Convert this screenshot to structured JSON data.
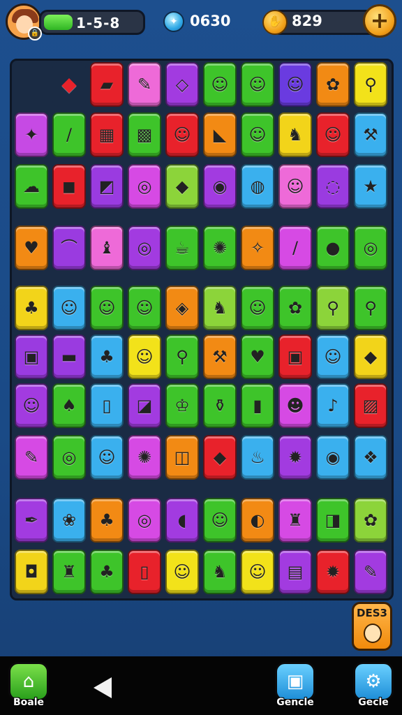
{
  "hud": {
    "level_text": "1-5-8",
    "level_progress": 0.3,
    "lock_glyph": "🔒",
    "gem_count": "0630",
    "gem_glyph": "✦",
    "coin_count": "829",
    "coin_glyph": "✋",
    "plus_label": "+"
  },
  "board": {
    "rows": [
      [
        "",
        "◆",
        "▰",
        "✎",
        "◇",
        "☺",
        "☺",
        "☺",
        "✿",
        "⚲"
      ],
      [
        "✦",
        "/",
        "▦",
        "▩",
        "☺",
        "◣",
        "☺",
        "♞",
        "☺",
        "⚒"
      ],
      [
        "☁",
        "◼",
        "◩",
        "◎",
        "◆",
        "◉",
        "◍",
        "☺",
        "◌",
        "★"
      ],
      [
        "♥",
        "⌒",
        "♝",
        "◎",
        "☕",
        "✺",
        "✧",
        "/",
        "●",
        "◎"
      ],
      [
        "♣",
        "☺",
        "☺",
        "☺",
        "◈",
        "♞",
        "☺",
        "✿",
        "⚲",
        "⚲"
      ],
      [
        "▣",
        "▬",
        "♣",
        "☺",
        "⚲",
        "⚒",
        "♥",
        "▣",
        "☺",
        "◆"
      ],
      [
        "☺",
        "♠",
        "▯",
        "◪",
        "♔",
        "⚱",
        "▮",
        "☻",
        "♪",
        "▨"
      ],
      [
        "✎",
        "◎",
        "☺",
        "✺",
        "◫",
        "◆",
        "♨",
        "✹",
        "◉",
        "❖"
      ],
      [
        "✒",
        "❀",
        "♣",
        "◎",
        "◖",
        "☺",
        "◐",
        "♜",
        "◨",
        "✿"
      ],
      [
        "◘",
        "♜",
        "♣",
        "▯",
        "☺",
        "♞",
        "☺",
        "▤",
        "✹",
        "✎"
      ]
    ],
    "colors": [
      [
        "#1a2b44",
        "#1a2b44",
        "#e8222b",
        "#ee6ad8",
        "#a23be0",
        "#3ec42a",
        "#3ec42a",
        "#6a3be0",
        "#f28a14",
        "#f2e21a"
      ],
      [
        "#c64ae4",
        "#3ec42a",
        "#e8222b",
        "#3ec42a",
        "#e8222b",
        "#f28a14",
        "#3ec42a",
        "#f2d41a",
        "#e8222b",
        "#3ab0ee"
      ],
      [
        "#3ec42a",
        "#e8222b",
        "#9a3be0",
        "#d64ae4",
        "#8cd43a",
        "#a23be0",
        "#3ab0ee",
        "#ee6ad8",
        "#9a3be0",
        "#3ab0ee"
      ],
      [
        "#f28a14",
        "#9a3be0",
        "#ee6ad8",
        "#a23be0",
        "#3ec42a",
        "#3ec42a",
        "#f28a14",
        "#d64ae4",
        "#3ec42a",
        "#3ec42a"
      ],
      [
        "#f2d41a",
        "#3ab0ee",
        "#3ec42a",
        "#3ec42a",
        "#f28a14",
        "#8cd43a",
        "#3ec42a",
        "#3ec42a",
        "#8cd43a",
        "#3ec42a"
      ],
      [
        "#9a3be0",
        "#9a3be0",
        "#3ab0ee",
        "#f2e21a",
        "#3ec42a",
        "#f28a14",
        "#3ec42a",
        "#e8222b",
        "#3ab0ee",
        "#f2d41a"
      ],
      [
        "#a23be0",
        "#3ec42a",
        "#3ab0ee",
        "#a23be0",
        "#3ec42a",
        "#3ec42a",
        "#3ec42a",
        "#d64ae4",
        "#3ab0ee",
        "#e8222b"
      ],
      [
        "#d64ae4",
        "#3ec42a",
        "#3ab0ee",
        "#d64ae4",
        "#f28a14",
        "#e8222b",
        "#3ab0ee",
        "#a23be0",
        "#3ab0ee",
        "#3ab0ee"
      ],
      [
        "#a23be0",
        "#3ab0ee",
        "#f28a14",
        "#d64ae4",
        "#a23be0",
        "#3ec42a",
        "#f28a14",
        "#d64ae4",
        "#3ec42a",
        "#8cd43a"
      ],
      [
        "#f2d41a",
        "#3ec42a",
        "#3ec42a",
        "#e8222b",
        "#f2e21a",
        "#3ec42a",
        "#f2e21a",
        "#a23be0",
        "#e8222b",
        "#a23be0"
      ]
    ]
  },
  "side_button": {
    "label": "DES3"
  },
  "navbar": {
    "left_label": "Boale",
    "left_icon": "⌂",
    "back_label": "◀",
    "mid_label": "Gencle",
    "mid_icon": "▣",
    "right_label": "Gecle",
    "right_icon": "⚙"
  },
  "palette": {
    "accent_gold": "#f2a01a",
    "board_bg": "#1a2b44",
    "page_bg": "#1d4f8e"
  }
}
